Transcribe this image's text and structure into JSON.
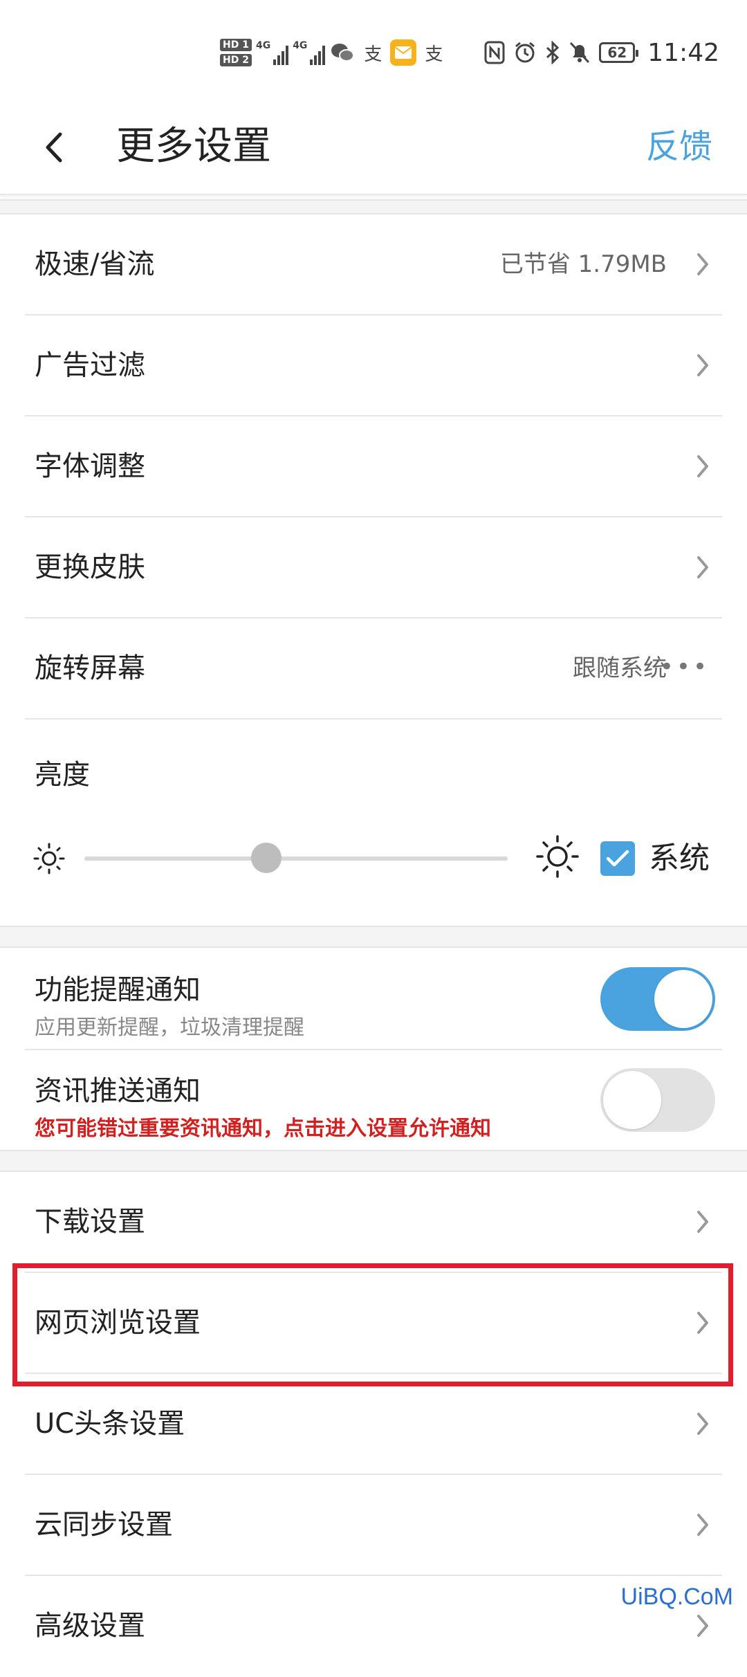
{
  "status_bar": {
    "sim1": "HD 1",
    "sim2": "HD 2",
    "network1": "4G",
    "network2": "4G",
    "battery": "62",
    "time": "11:42",
    "icons": [
      "wechat-icon",
      "alipay-icon",
      "mail-icon",
      "alipay-icon",
      "nfc-icon",
      "alarm-icon",
      "bluetooth-icon",
      "mute-icon"
    ]
  },
  "header": {
    "title": "更多设置",
    "feedback": "反馈",
    "accent_color": "#4aa3df"
  },
  "section1": {
    "rows": [
      {
        "label": "极速/省流",
        "value": "已节省 1.79MB"
      },
      {
        "label": "广告过滤",
        "value": ""
      },
      {
        "label": "字体调整",
        "value": ""
      },
      {
        "label": "更换皮肤",
        "value": ""
      },
      {
        "label": "旋转屏幕",
        "value": "跟随系统"
      }
    ]
  },
  "brightness": {
    "title": "亮度",
    "level": 0.43,
    "system_checked": true,
    "system_label": "系统"
  },
  "notifications": {
    "feature": {
      "title": "功能提醒通知",
      "subtitle": "应用更新提醒，垃圾清理提醒",
      "enabled": true
    },
    "news": {
      "title": "资讯推送通知",
      "subtitle": "您可能错过重要资讯通知，点击进入设置允许通知",
      "enabled": false,
      "warning_color": "#d21f1f"
    }
  },
  "section3": {
    "rows": [
      {
        "label": "下载设置"
      },
      {
        "label": "网页浏览设置"
      },
      {
        "label": "UC头条设置"
      },
      {
        "label": "云同步设置"
      },
      {
        "label": "高级设置"
      }
    ],
    "highlight_color": "#e01e2e"
  },
  "watermark": "UiBQ.CoM"
}
